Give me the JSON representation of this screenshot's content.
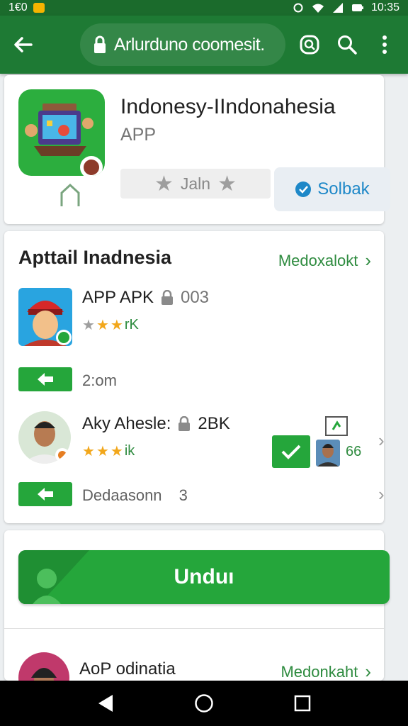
{
  "status_bar": {
    "left_text": "1€0",
    "time": "10:35"
  },
  "app_bar": {
    "url": "Arlurduno coomesit."
  },
  "app_card": {
    "title": "Indonesy-IIndonahesia",
    "subtitle": "APP",
    "rating_label": "Jaln",
    "solbak_label": "Solbak"
  },
  "section": {
    "title": "Apttail Inadnesia",
    "link": "Medoxalokt",
    "items": [
      {
        "title": "APP APK",
        "meta": "003",
        "rating_suffix": "rK",
        "stars": 3,
        "action_text": "2:om"
      },
      {
        "title": "Aky Ahesle:",
        "meta": "2BK",
        "rating_suffix": "ik",
        "stars": 3,
        "action_text": "Dedaasonn",
        "action_count": "3",
        "side_count": "66"
      }
    ]
  },
  "download": {
    "label": "Unduı"
  },
  "bottom_row": {
    "title": "AoP odinatia",
    "link": "Medonkaht"
  },
  "colors": {
    "primary": "#1e7a34",
    "accent": "#25a63b",
    "link": "#2e8b3f",
    "star": "#f2a71b"
  },
  "icons": [
    "back-arrow-icon",
    "lock-icon",
    "tab-search-icon",
    "search-icon",
    "overflow-menu-icon",
    "house-icon",
    "star-icon",
    "check-circle-icon",
    "chevron-right-icon",
    "download-arrow-icon",
    "check-icon",
    "nav-back-icon",
    "nav-home-icon",
    "nav-recents-icon"
  ]
}
